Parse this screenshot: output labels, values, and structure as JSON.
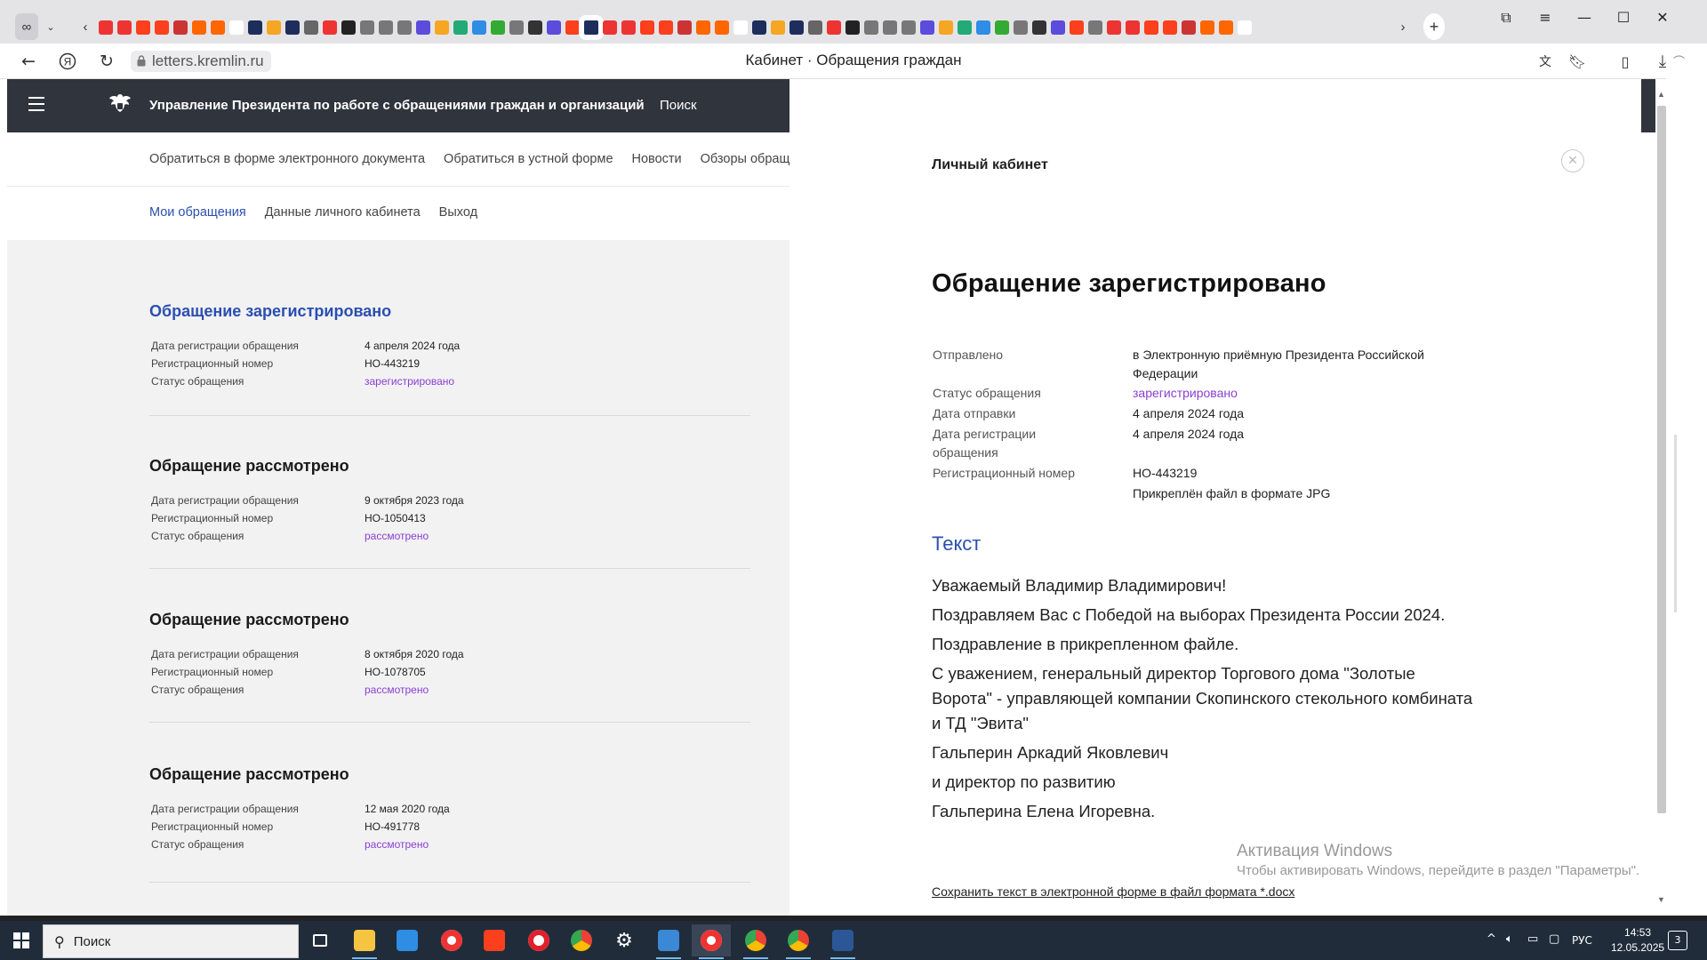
{
  "browser": {
    "url": "letters.kremlin.ru",
    "page_title": "Кабинет · Обращения граждан",
    "tabs_count": 62
  },
  "site": {
    "org_title": "Управление Президента по работе с обращениями граждан и организаций",
    "search_label": "Поиск",
    "nav": [
      "Обратиться в форме электронного документа",
      "Обратиться в устной форме",
      "Новости",
      "Обзоры обращений"
    ],
    "sub_nav": [
      "Мои обращения",
      "Данные личного кабинета",
      "Выход"
    ]
  },
  "appeals": [
    {
      "title": "Обращение зарегистрировано",
      "date_label": "Дата регистрации обращения",
      "date": "4 апреля 2024 года",
      "number_label": "Регистрационный номер",
      "number": "НО-443219",
      "status_label": "Статус обращения",
      "status": "зарегистрировано"
    },
    {
      "title": "Обращение рассмотрено",
      "date_label": "Дата регистрации обращения",
      "date": "9 октября 2023 года",
      "number_label": "Регистрационный номер",
      "number": "НО-1050413",
      "status_label": "Статус обращения",
      "status": "рассмотрено"
    },
    {
      "title": "Обращение рассмотрено",
      "date_label": "Дата регистрации обращения",
      "date": "8 октября 2020 года",
      "number_label": "Регистрационный номер",
      "number": "НО-1078705",
      "status_label": "Статус обращения",
      "status": "рассмотрено"
    },
    {
      "title": "Обращение рассмотрено",
      "date_label": "Дата регистрации обращения",
      "date": "12 мая 2020 года",
      "number_label": "Регистрационный номер",
      "number": "НО-491778",
      "status_label": "Статус обращения",
      "status": "рассмотрено"
    }
  ],
  "panel": {
    "heading": "Личный кабинет",
    "title": "Обращение зарегистрировано",
    "sent_label": "Отправлено",
    "sent_value": "в Электронную приёмную Президента Российской Федерации",
    "status_label": "Статус обращения",
    "status_value": "зарегистрировано",
    "send_date_label": "Дата отправки",
    "send_date_value": "4 апреля 2024 года",
    "reg_date_label": "Дата регистрации обращения",
    "reg_date_value": "4 апреля 2024 года",
    "reg_number_label": "Регистрационный номер",
    "reg_number_value": "НО-443219",
    "attachment": "Прикреплён файл в формате JPG",
    "text_heading": "Текст",
    "letter": [
      "Уважаемый Владимир Владимирович!",
      "Поздравляем Вас с Победой на выборах Президента России 2024.",
      "Поздравление в прикрепленном файле.",
      "С уважением, генеральный директор Торгового дома \"Золотые Ворота\" - управляющей компании Скопинского стекольного комбината и ТД \"Эвита\"",
      "Гальперин Аркадий Яковлевич",
      "и директор по развитию",
      "Гальперина Елена Игоревна."
    ],
    "save_link": "Сохранить текст в электронной форме в файл формата *.docx"
  },
  "activation": {
    "title": "Активация Windows",
    "subtitle": "Чтобы активировать Windows, перейдите в раздел \"Параметры\"."
  },
  "taskbar": {
    "search_placeholder": "Поиск",
    "language": "РУС",
    "time": "14:53",
    "date": "12.05.2025",
    "notifications": "3"
  },
  "colors": {
    "header_bg": "#30343d",
    "link_blue": "#2a4fb0",
    "status_purple": "#8a3fd1",
    "list_bg": "#f2f2f3",
    "taskbar_bg": "#202c3a"
  }
}
